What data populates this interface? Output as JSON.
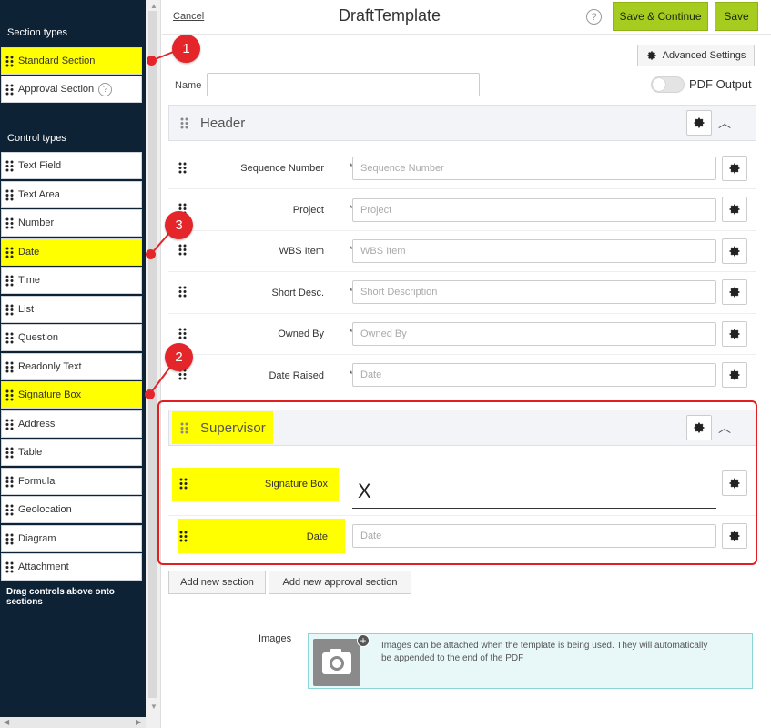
{
  "sidebar": {
    "section_types_heading": "Section types",
    "section_types": [
      {
        "label": "Standard Section"
      },
      {
        "label": "Approval Section"
      }
    ],
    "control_types_heading": "Control types",
    "control_types": [
      {
        "label": "Text Field"
      },
      {
        "label": "Text Area"
      },
      {
        "label": "Number"
      },
      {
        "label": "Date"
      },
      {
        "label": "Time"
      },
      {
        "label": "List"
      },
      {
        "label": "Question"
      },
      {
        "label": "Readonly Text"
      },
      {
        "label": "Signature Box"
      },
      {
        "label": "Address"
      },
      {
        "label": "Table"
      },
      {
        "label": "Formula"
      },
      {
        "label": "Geolocation"
      },
      {
        "label": "Diagram"
      },
      {
        "label": "Attachment"
      }
    ],
    "footer": "Drag controls above onto sections"
  },
  "header": {
    "cancel": "Cancel",
    "title": "DraftTemplate",
    "help": "?",
    "save_continue": "Save & Continue",
    "save": "Save"
  },
  "settings": {
    "advanced": "Advanced Settings",
    "name_label": "Name",
    "name_value": "",
    "pdf_output": "PDF Output"
  },
  "sections": {
    "header": {
      "title": "Header",
      "fields": [
        {
          "label": "Sequence Number",
          "star": "*",
          "placeholder": "Sequence Number"
        },
        {
          "label": "Project",
          "star": "*",
          "placeholder": "Project"
        },
        {
          "label": "WBS Item",
          "star": "*",
          "placeholder": "WBS Item"
        },
        {
          "label": "Short Desc.",
          "star": "*",
          "placeholder": "Short Description"
        },
        {
          "label": "Owned By",
          "star": "*",
          "placeholder": "Owned By"
        },
        {
          "label": "Date Raised",
          "star": "*",
          "placeholder": "Date"
        }
      ]
    },
    "supervisor": {
      "title": "Supervisor",
      "signature_label": "Signature Box",
      "signature_mark": "X",
      "date_label": "Date",
      "date_placeholder": "Date"
    }
  },
  "actions": {
    "add_section": "Add new section",
    "add_approval_section": "Add new approval section"
  },
  "images": {
    "label": "Images",
    "text": "Images can be attached when the template is being used. They will automatically be appended to the end of the PDF",
    "plus": "+"
  },
  "markers": [
    "1",
    "2",
    "3"
  ],
  "colors": {
    "sidebar_bg": "#0e2236",
    "highlight": "#ffff00",
    "accent_green": "#a6cc1f",
    "marker_red": "#e42529"
  }
}
